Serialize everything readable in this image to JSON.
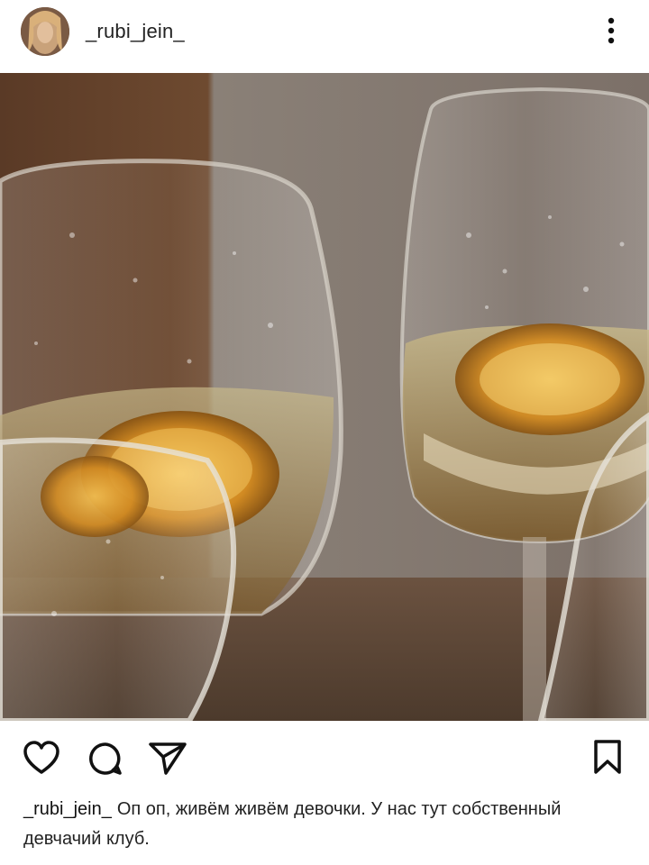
{
  "post": {
    "username": "_rubi_jein_",
    "caption_user": "_rubi_jein_",
    "caption_text": "Оп оп, живём живём девочки. У нас тут собственный девчачий клуб."
  },
  "icons": {
    "more": "more-vertical-icon",
    "like": "heart-icon",
    "comment": "comment-icon",
    "share": "send-icon",
    "save": "bookmark-icon"
  },
  "colors": {
    "background": "#ffffff",
    "text": "#222222",
    "icon": "#111111"
  }
}
